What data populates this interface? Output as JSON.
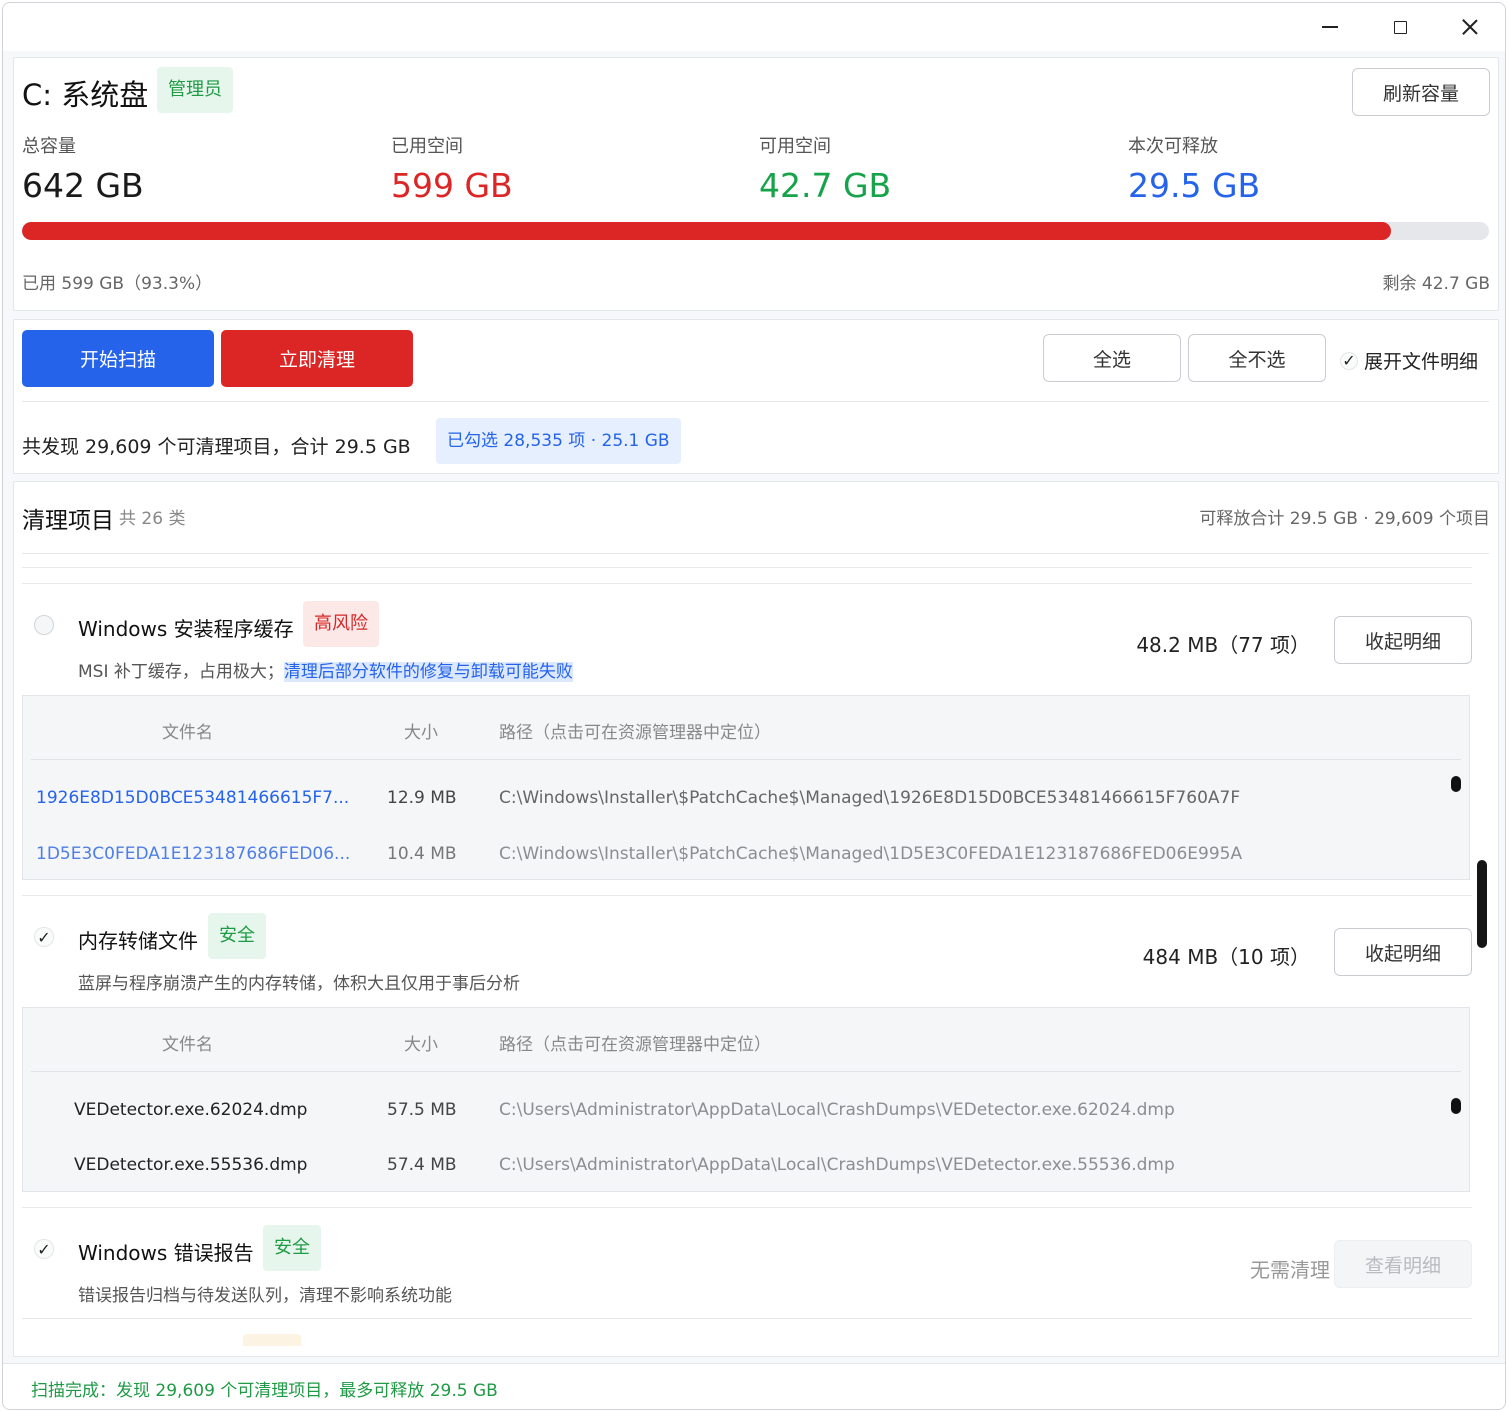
{
  "window": {
    "controls": [
      "minimize",
      "maximize",
      "close"
    ]
  },
  "drive": {
    "title": "C: 系统盘",
    "admin_badge": "管理员",
    "refresh_label": "刷新容量",
    "stats": [
      {
        "label": "总容量",
        "value": "642 GB",
        "color": "#1a1a1a"
      },
      {
        "label": "已用空间",
        "value": "599 GB",
        "color": "#dc2626"
      },
      {
        "label": "可用空间",
        "value": "42.7 GB",
        "color": "#16a34a"
      },
      {
        "label": "本次可释放",
        "value": "29.5 GB",
        "color": "#2563eb"
      }
    ],
    "used_fraction": 0.933,
    "used_text": "已用 599 GB（93.3%）",
    "remaining_text": "剩余 42.7 GB"
  },
  "actions": {
    "scan_label": "开始扫描",
    "clean_label": "立即清理",
    "select_all_label": "全选",
    "select_none_label": "全不选",
    "expand_details_label": "展开文件明细",
    "expand_details_checked": true,
    "summary_text": "共发现 29,609 个可清理项目，合计 29.5 GB",
    "selected_badge": "已勾选 28,535 项 · 25.1 GB"
  },
  "items": {
    "title": "清理项目",
    "count_text": "共 26 类",
    "total_text": "可释放合计 29.5 GB · 29,609 个项目",
    "groups": [
      {
        "name": "Windows 安装程序缓存",
        "risk": "高风险",
        "checked": false,
        "desc_plain": "MSI 补丁缓存，占用极大；",
        "desc_highlight": "清理后部分软件的修复与卸载可能失败",
        "size": "48.2 MB（77 项）",
        "button": "收起明细",
        "columns": [
          "文件名",
          "大小",
          "路径（点击可在资源管理器中定位）"
        ],
        "rows": [
          {
            "name": "1926E8D15D0BCE53481466615F7...",
            "size": "12.9 MB",
            "path": "C:\\Windows\\Installer\\$PatchCache$\\Managed\\1926E8D15D0BCE53481466615F760A7F"
          },
          {
            "name": "1D5E3C0FEDA1E123187686FED06...",
            "size": "10.4 MB",
            "path": "C:\\Windows\\Installer\\$PatchCache$\\Managed\\1D5E3C0FEDA1E123187686FED06E995A"
          }
        ]
      },
      {
        "name": "内存转储文件",
        "risk": "安全",
        "checked": true,
        "desc_plain": "蓝屏与程序崩溃产生的内存转储，体积大且仅用于事后分析",
        "size": "484 MB（10 项）",
        "button": "收起明细",
        "columns": [
          "文件名",
          "大小",
          "路径（点击可在资源管理器中定位）"
        ],
        "rows": [
          {
            "name": "VEDetector.exe.62024.dmp",
            "size": "57.5 MB",
            "path": "C:\\Users\\Administrator\\AppData\\Local\\CrashDumps\\VEDetector.exe.62024.dmp"
          },
          {
            "name": "VEDetector.exe.55536.dmp",
            "size": "57.4 MB",
            "path": "C:\\Users\\Administrator\\AppData\\Local\\CrashDumps\\VEDetector.exe.55536.dmp"
          }
        ]
      },
      {
        "name": "Windows 错误报告",
        "risk": "安全",
        "checked": true,
        "desc_plain": "错误报告归档与待发送队列，清理不影响系统功能",
        "size": "无需清理",
        "button": "查看明细"
      }
    ]
  },
  "status": {
    "text": "扫描完成：发现 29,609 个可清理项目，最多可释放 29.5 GB"
  }
}
